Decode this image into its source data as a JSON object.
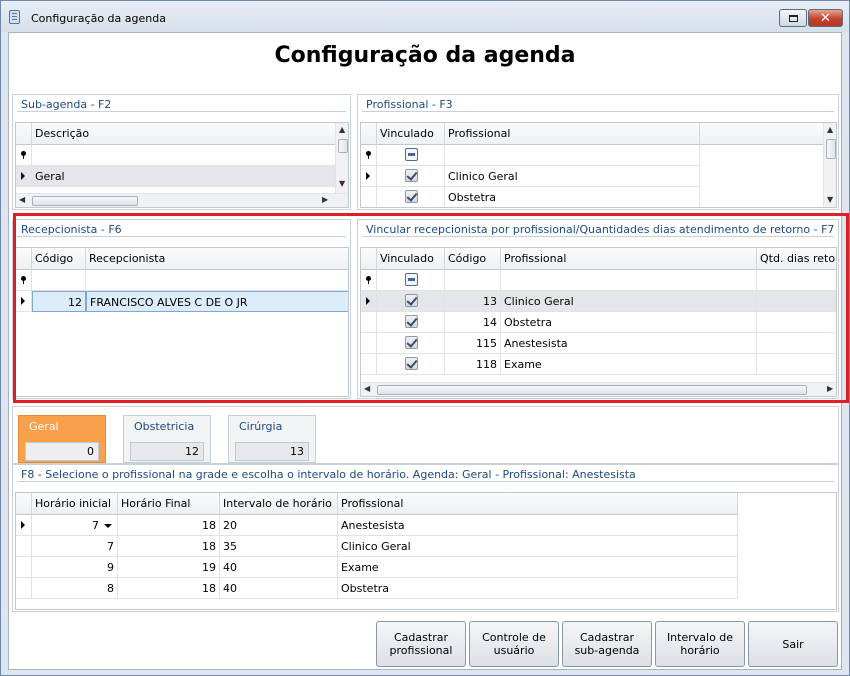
{
  "window": {
    "title": "Configuração da agenda",
    "close_glyph": "✕"
  },
  "header": {
    "title": "Configuração da agenda"
  },
  "subagenda": {
    "title": "Sub-agenda - F2",
    "col_descricao": "Descrição",
    "rows": [
      "Geral"
    ]
  },
  "profissional": {
    "title": "Profissional - F3",
    "col_vinculado": "Vinculado",
    "col_profissional": "Profissional",
    "rows": [
      {
        "vinculado": true,
        "nome": "Clinico Geral"
      },
      {
        "vinculado": true,
        "nome": "Obstetra"
      }
    ]
  },
  "recepcionista": {
    "title": "Recepcionista - F6",
    "col_codigo": "Código",
    "col_recepcionista": "Recepcionista",
    "rows": [
      {
        "codigo": "12",
        "nome": "FRANCISCO ALVES C DE O JR"
      }
    ]
  },
  "vincular": {
    "title": "Vincular recepcionista por profissional/Quantidades dias atendimento de retorno - F7",
    "col_vinculado": "Vinculado",
    "col_codigo": "Código",
    "col_profissional": "Profissional",
    "col_qtd": "Qtd. dias retorno",
    "rows": [
      {
        "vinculado": true,
        "codigo": "13",
        "nome": "Clinico Geral"
      },
      {
        "vinculado": true,
        "codigo": "14",
        "nome": "Obstetra"
      },
      {
        "vinculado": true,
        "codigo": "115",
        "nome": "Anestesista"
      },
      {
        "vinculado": true,
        "codigo": "118",
        "nome": "Exame"
      }
    ]
  },
  "tiles": [
    {
      "label": "Geral",
      "value": "0",
      "active": true
    },
    {
      "label": "Obstetricia",
      "value": "12",
      "active": false
    },
    {
      "label": "Cirúrgia",
      "value": "13",
      "active": false
    }
  ],
  "horarios": {
    "title": "F8 - Selecione o profissional na grade e escolha o intervalo de horário. Agenda: Geral - Profissional: Anestesista",
    "col_inicial": "Horário inicial",
    "col_final": "Horário Final",
    "col_intervalo": "Intervalo de horário",
    "col_profissional": "Profissional",
    "rows": [
      {
        "inicial": "7",
        "final": "18",
        "intervalo": "20",
        "profissional": "Anestesista"
      },
      {
        "inicial": "7",
        "final": "18",
        "intervalo": "35",
        "profissional": "Clinico Geral"
      },
      {
        "inicial": "9",
        "final": "19",
        "intervalo": "40",
        "profissional": "Exame"
      },
      {
        "inicial": "8",
        "final": "18",
        "intervalo": "40",
        "profissional": "Obstetra"
      }
    ]
  },
  "buttons": {
    "cadastrar_profissional": [
      "Cadastrar",
      "profissional"
    ],
    "controle_usuario": [
      "Controle de",
      "usuário"
    ],
    "cadastrar_subagenda": [
      "Cadastrar",
      "sub-agenda"
    ],
    "intervalo_horario": [
      "Intervalo de",
      "horário"
    ],
    "sair": "Sair"
  },
  "colors": {
    "accent_tile": "#f8a04a",
    "highlight": "#e01f24",
    "panel_title": "#1e4a80"
  }
}
